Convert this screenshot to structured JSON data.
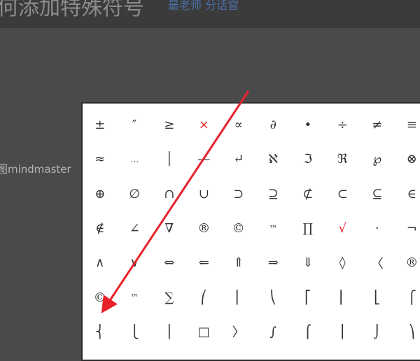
{
  "header": {
    "title": "何添加特殊符号",
    "author": "最老师 分话官"
  },
  "body": {
    "side_text": "图mindmaster"
  },
  "symbol_panel": {
    "accent_color": "#e8222a",
    "rows": [
      [
        "±",
        "″",
        "≥",
        "×",
        "∝",
        "∂",
        "•",
        "÷",
        "≠",
        "≡"
      ],
      [
        "≈",
        "…",
        "│",
        "—",
        "↵",
        "ℵ",
        "ℑ",
        "ℜ",
        "℘",
        "⊗"
      ],
      [
        "⊕",
        "∅",
        "∩",
        "∪",
        "⊃",
        "⊇",
        "⊄",
        "⊂",
        "⊆",
        "∈"
      ],
      [
        "∉",
        "∠",
        "∇",
        "®",
        "©",
        "™",
        "∏",
        "√",
        "·",
        "¬"
      ],
      [
        "∧",
        "∨",
        "⇔",
        "⇐",
        "⇑",
        "⇒",
        "⇓",
        "◊",
        "〈",
        "®"
      ],
      [
        "©",
        "™",
        "∑",
        "⎛",
        "⎜",
        "⎝",
        "⎡",
        "⎢",
        "⎣",
        "⎧"
      ],
      [
        "⎨",
        "⎩",
        "⎪",
        "□",
        "〉",
        "∫",
        "⌠",
        "⎮",
        "⌡",
        "⎞"
      ]
    ],
    "red_cells": [
      "×",
      "√"
    ]
  }
}
